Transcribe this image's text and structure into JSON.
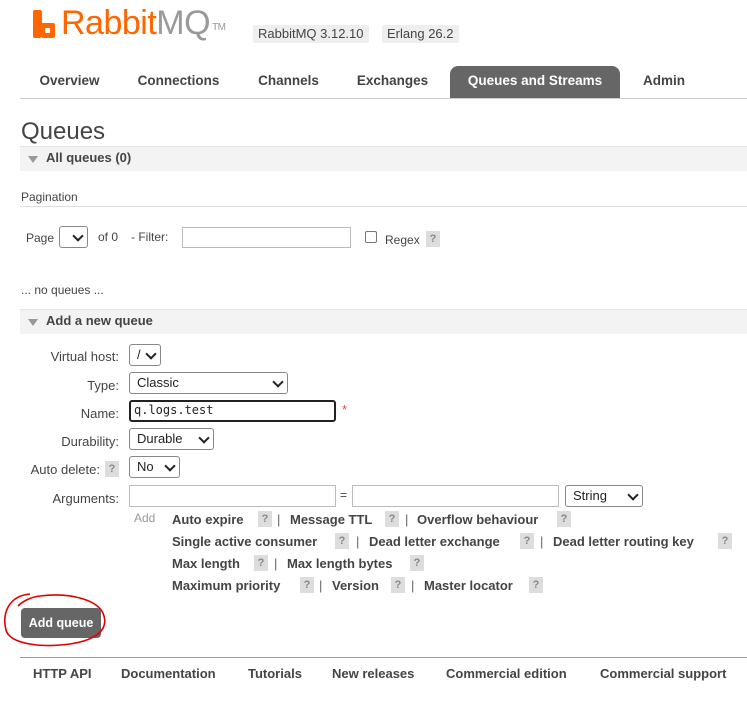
{
  "header": {
    "logo_rabbit": "Rabbit",
    "logo_mq": "MQ",
    "logo_tm": "TM",
    "version": "RabbitMQ 3.12.10",
    "erlang": "Erlang 26.2"
  },
  "tabs": [
    "Overview",
    "Connections",
    "Channels",
    "Exchanges",
    "Queues and Streams",
    "Admin"
  ],
  "active_tab": "Queues and Streams",
  "page_title": "Queues",
  "all_queues": {
    "label": "All queues (0)"
  },
  "pagination": {
    "heading": "Pagination",
    "page_label": "Page",
    "of_label": "of 0",
    "filter_label": "- Filter:",
    "filter_value": "",
    "regex_label": "Regex",
    "help": "?"
  },
  "no_queues": "... no queues ...",
  "add_queue_section": {
    "label": "Add a new queue",
    "virtual_host_label": "Virtual host:",
    "virtual_host_value": "/",
    "type_label": "Type:",
    "type_value": "Classic",
    "name_label": "Name:",
    "name_value": "q.logs.test",
    "required_mark": "*",
    "durability_label": "Durability:",
    "durability_value": "Durable",
    "auto_delete_label": "Auto delete:",
    "auto_delete_value": "No",
    "arguments_label": "Arguments:",
    "equals": "=",
    "arg_type_value": "String",
    "add_label": "Add",
    "arg_links": [
      "Auto expire",
      "Message TTL",
      "Overflow behaviour",
      "Single active consumer",
      "Dead letter exchange",
      "Dead letter routing key",
      "Max length",
      "Max length bytes",
      "Maximum priority",
      "Version",
      "Master locator"
    ],
    "separator": "|",
    "button_label": "Add queue"
  },
  "footer": [
    "HTTP API",
    "Documentation",
    "Tutorials",
    "New releases",
    "Commercial edition",
    "Commercial support"
  ],
  "colors": {
    "brand_orange": "#ff6600",
    "active_tab_bg": "#666666",
    "annotation_red": "#e00000"
  }
}
